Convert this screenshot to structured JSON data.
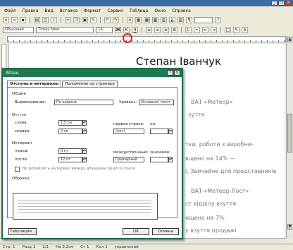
{
  "menubar": {
    "items": [
      "Файл",
      "Правка",
      "Вид",
      "Вставка",
      "Формат",
      "Сервис",
      "Таблица",
      "Окно",
      "Справка"
    ]
  },
  "toolbar2": {
    "style": "Обычный",
    "font": "Times New",
    "size": "14",
    "bold": "Ж",
    "italic": "К",
    "underline": "Ч"
  },
  "document": {
    "title": "Степан Іванчук",
    "lines": [
      "ВАТ «Метеор»",
      "зуття",
      "тки, роботи з виробни-",
      "вщено на 14% —",
      "і, Звичайне для представників",
      "ВАТ «Метеор-Лост»",
      "ст відділу взуття",
      "ищено на 7%",
      "у взуття продажі"
    ]
  },
  "dialog": {
    "title": "Абзац",
    "tabs": [
      "Отступы и интервалы",
      "Положение на странице"
    ],
    "groups": {
      "general": "Общие",
      "indent": "Отступ",
      "spacing": "Интервал",
      "sample": "Образец"
    },
    "labels": {
      "alignment": "Выравнивание:",
      "level": "Уровень:",
      "left": "слева:",
      "right": "справа:",
      "first_line": "первая строка:",
      "by_indent": "на:",
      "before": "перед:",
      "after": "после:",
      "line_spacing": "междустрочный:",
      "value": "значение:"
    },
    "values": {
      "alignment": "По ширине",
      "level": "Основной текст",
      "left": "1,5 см",
      "right": "0 см",
      "first_line": "(нет)",
      "before": "0 пт",
      "after": "12 пт",
      "line_spacing": "Одинарный"
    },
    "checkbox_label": "Не добавлять интервал между абзацами одного стиля",
    "buttons": {
      "tabs": "Табуляция...",
      "ok": "ОК",
      "cancel": "Отмена"
    }
  },
  "statusbar": {
    "page": "Стр. 1",
    "section": "Разд 1",
    "pages": "1/1",
    "position": "На 3,2см",
    "line": "Ст 1",
    "column": "Кол 1",
    "language": "украинский"
  }
}
